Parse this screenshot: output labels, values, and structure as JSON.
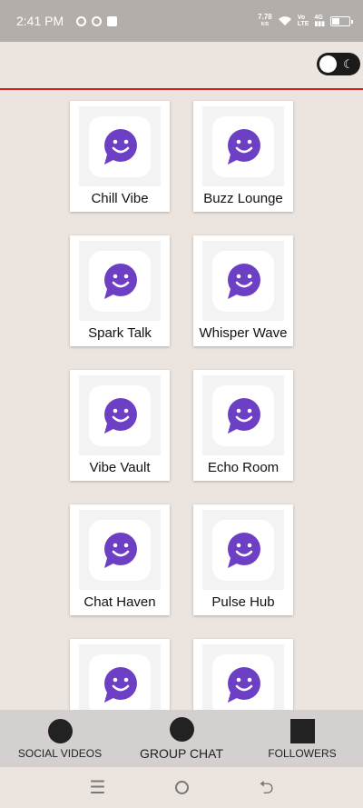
{
  "status_bar": {
    "time": "2:41 PM",
    "net_speed": "7.78",
    "net_unit": "K/S",
    "lte_top": "Vo",
    "lte_bottom": "LTE",
    "signal": "4G"
  },
  "theme_toggle": {
    "icon": "moon-icon",
    "state": "light"
  },
  "rooms": [
    {
      "name": "Chill Vibe"
    },
    {
      "name": "Buzz Lounge"
    },
    {
      "name": "Spark Talk"
    },
    {
      "name": "Whisper Wave"
    },
    {
      "name": "Vibe Vault"
    },
    {
      "name": "Echo Room"
    },
    {
      "name": "Chat Haven"
    },
    {
      "name": "Pulse Hub"
    },
    {
      "name": ""
    },
    {
      "name": ""
    }
  ],
  "room_icon": {
    "name": "chat-smile-icon",
    "color": "#6c3fc4"
  },
  "bottom_nav": {
    "items": [
      {
        "label": "SOCIAL VIDEOS",
        "icon": "circle-icon"
      },
      {
        "label": "GROUP CHAT",
        "icon": "circle-icon",
        "active": true
      },
      {
        "label": "FOLLOWERS",
        "icon": "square-icon"
      }
    ]
  },
  "colors": {
    "background": "#ece5df",
    "status_bar": "#b4aeaa",
    "header_divider": "#d32020",
    "bottom_nav": "#d3d0cf"
  }
}
